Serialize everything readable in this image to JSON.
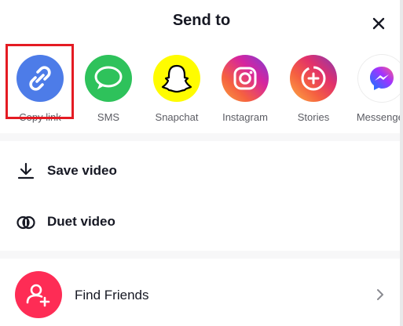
{
  "header": {
    "title": "Send to"
  },
  "share_options": [
    {
      "label": "Copy link",
      "icon": "link-icon",
      "color": "#4d7ce8"
    },
    {
      "label": "SMS",
      "icon": "sms-bubble-icon",
      "color": "#2ec25b"
    },
    {
      "label": "Snapchat",
      "icon": "snapchat-ghost-icon",
      "color": "#fffc00"
    },
    {
      "label": "Instagram",
      "icon": "instagram-icon",
      "color": "#d6249f"
    },
    {
      "label": "Stories",
      "icon": "stories-add-icon",
      "color": "#e1306c"
    },
    {
      "label": "Messenger",
      "icon": "messenger-icon",
      "color": "#0a7cff"
    }
  ],
  "actions": [
    {
      "label": "Save video",
      "icon": "download-icon"
    },
    {
      "label": "Duet video",
      "icon": "duet-icon"
    }
  ],
  "find_friends": {
    "label": "Find Friends",
    "icon": "add-person-icon",
    "color": "#fe2c55"
  },
  "colors": {
    "highlight": "#e41b23",
    "divider": "#f7f7f8",
    "text": "#161823",
    "muted": "#5b5c63"
  }
}
